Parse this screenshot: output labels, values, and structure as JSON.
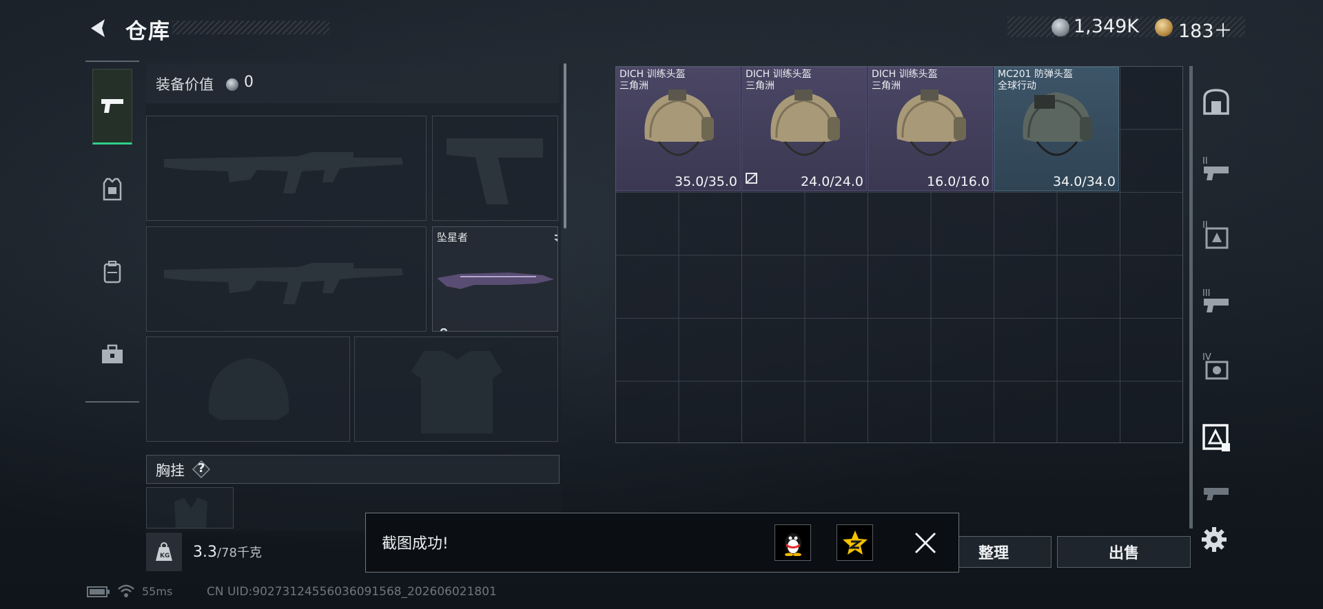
{
  "header": {
    "title": "仓库",
    "back_icon": "back-arrow-icon"
  },
  "currency": {
    "silver_value": "1,349K",
    "gold_value": "183＋"
  },
  "left_rail": {
    "tabs": [
      {
        "icon": "pistol-icon",
        "active": true
      },
      {
        "icon": "armor-vest-icon",
        "active": false
      },
      {
        "icon": "backpack-icon",
        "active": false
      },
      {
        "icon": "toolbox-icon",
        "active": false
      }
    ]
  },
  "equipment": {
    "value_label": "装备价值",
    "value": "0",
    "melee_name": "坠星者",
    "chest_label": "胸挂",
    "help": "?"
  },
  "weight": {
    "current": "3.3",
    "capacity": "/78千克",
    "icon_label": "KG"
  },
  "stash": {
    "items": [
      {
        "name": "DICH 训练头盔",
        "map": "三角洲",
        "durability": "35.0/35.0",
        "color": "#4a4664"
      },
      {
        "name": "DICH 训练头盔",
        "map": "三角洲",
        "durability": "24.0/24.0",
        "color": "#4a4664"
      },
      {
        "name": "DICH 训练头盔",
        "map": "三角洲",
        "durability": "16.0/16.0",
        "color": "#4a4664"
      },
      {
        "name": "MC201 防弹头盔",
        "map": "全球行动",
        "durability": "34.0/34.0",
        "color": "#3d5568"
      }
    ]
  },
  "right_sidebar": {
    "items": [
      {
        "label": "",
        "icon": "safe-box-icon"
      },
      {
        "label": "II",
        "icon": "tier-2-weapon-icon"
      },
      {
        "label": "II",
        "icon": "tier-2-armor-icon"
      },
      {
        "label": "III",
        "icon": "tier-3-weapon-icon"
      },
      {
        "label": "IV",
        "icon": "tier-4-icon"
      },
      {
        "label": "",
        "icon": "helmet-filter-icon",
        "active": true
      },
      {
        "label": "",
        "icon": "more-icon"
      }
    ]
  },
  "buttons": {
    "sort_label": "整理",
    "sell_label": "出售"
  },
  "toast": {
    "message": "截图成功!",
    "qq_icon": "qq-penguin-icon",
    "qzone_icon": "qzone-star-icon"
  },
  "status_bar": {
    "ping": "55ms",
    "uid": "CN UID:9027312455603609156​8_202606021801"
  },
  "colors": {
    "accent_green": "#2fd08a",
    "item_purple": "#4a4664",
    "item_blue": "#3d5568"
  }
}
